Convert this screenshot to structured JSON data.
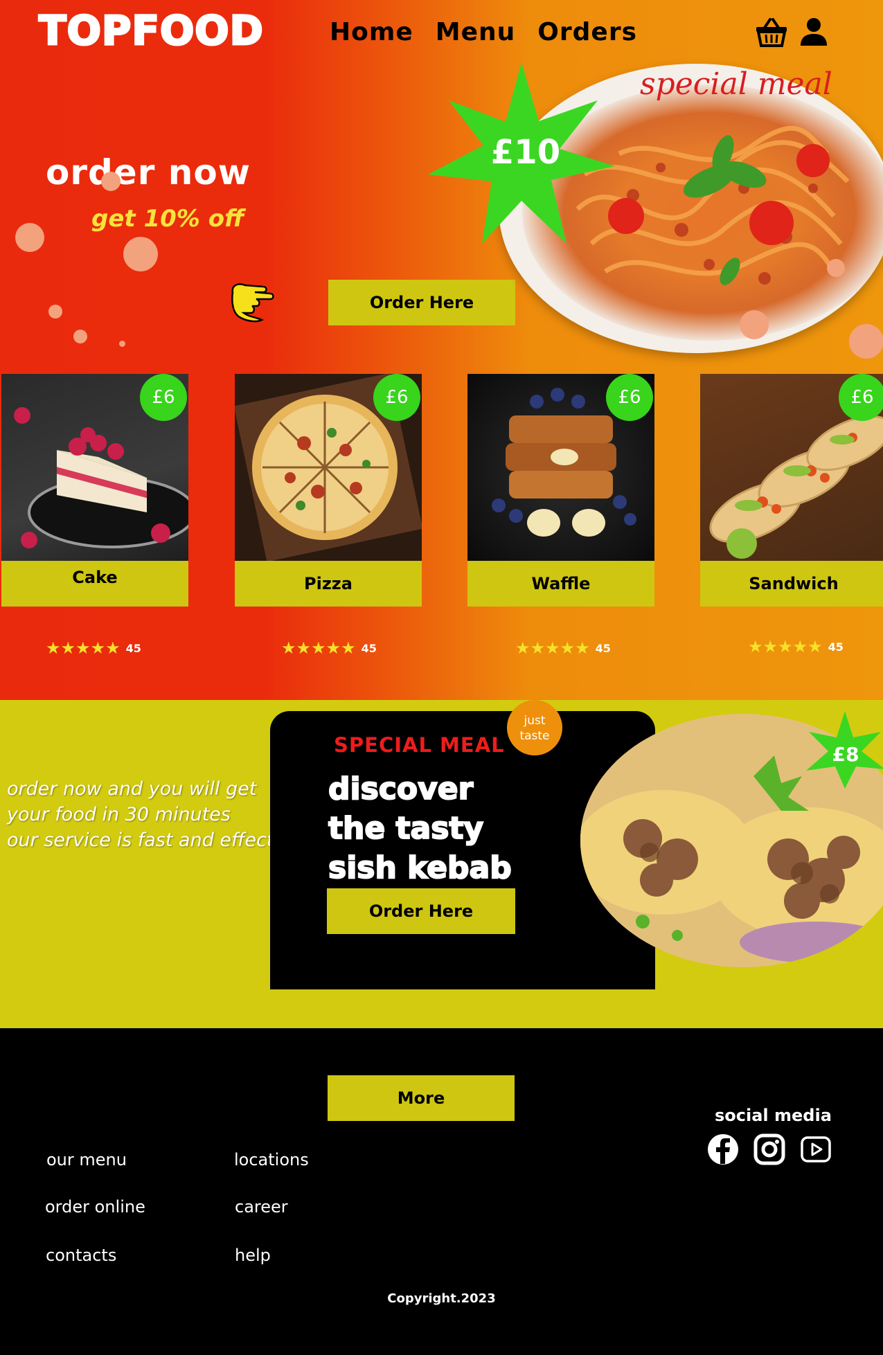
{
  "brand": {
    "logo": "TOPFOOD"
  },
  "nav": {
    "home": "Home",
    "menu": "Menu",
    "orders": "Orders"
  },
  "icons": {
    "basket": "basket-icon",
    "user": "user-icon",
    "pointer": "pointing-hand-icon"
  },
  "hero": {
    "headline": "order now",
    "discount": "get 10% off",
    "order_button": "Order Here",
    "special_label": "special meal",
    "special_price": "£10"
  },
  "cards": [
    {
      "name": "Cake",
      "price": "£6",
      "rating_count": "45"
    },
    {
      "name": "Pizza",
      "price": "£6",
      "rating_count": "45"
    },
    {
      "name": "Waffle",
      "price": "£6",
      "rating_count": "45"
    },
    {
      "name": "Sandwich",
      "price": "£6",
      "rating_count": "45"
    }
  ],
  "stars": "★★★★★",
  "special": {
    "promo_lines": [
      "order now and you will get",
      "your food in 30 minutes",
      "our service is fast and effective"
    ],
    "heading": "SPECIAL MEAL",
    "title_lines": [
      "discover",
      "the tasty",
      "sish kebab"
    ],
    "order_button": "Order Here",
    "badge_line1": "just",
    "badge_line2": "taste",
    "price": "£8"
  },
  "footer": {
    "more_button": "More",
    "links_col1": [
      "our menu",
      "order online",
      "contacts"
    ],
    "links_col2": [
      "locations",
      "career",
      "help"
    ],
    "social_title": "social media",
    "social_icons": [
      "facebook-icon",
      "instagram-icon",
      "youtube-icon"
    ],
    "copyright": "Copyright.2023"
  },
  "colors": {
    "hero_red": "#ea2a0c",
    "hero_orange": "#ee960c",
    "accent_yellow": "#cfc611",
    "section_yellow": "#d3cb0f",
    "badge_green": "#39d41c",
    "star_yellow": "#f6e12a"
  }
}
